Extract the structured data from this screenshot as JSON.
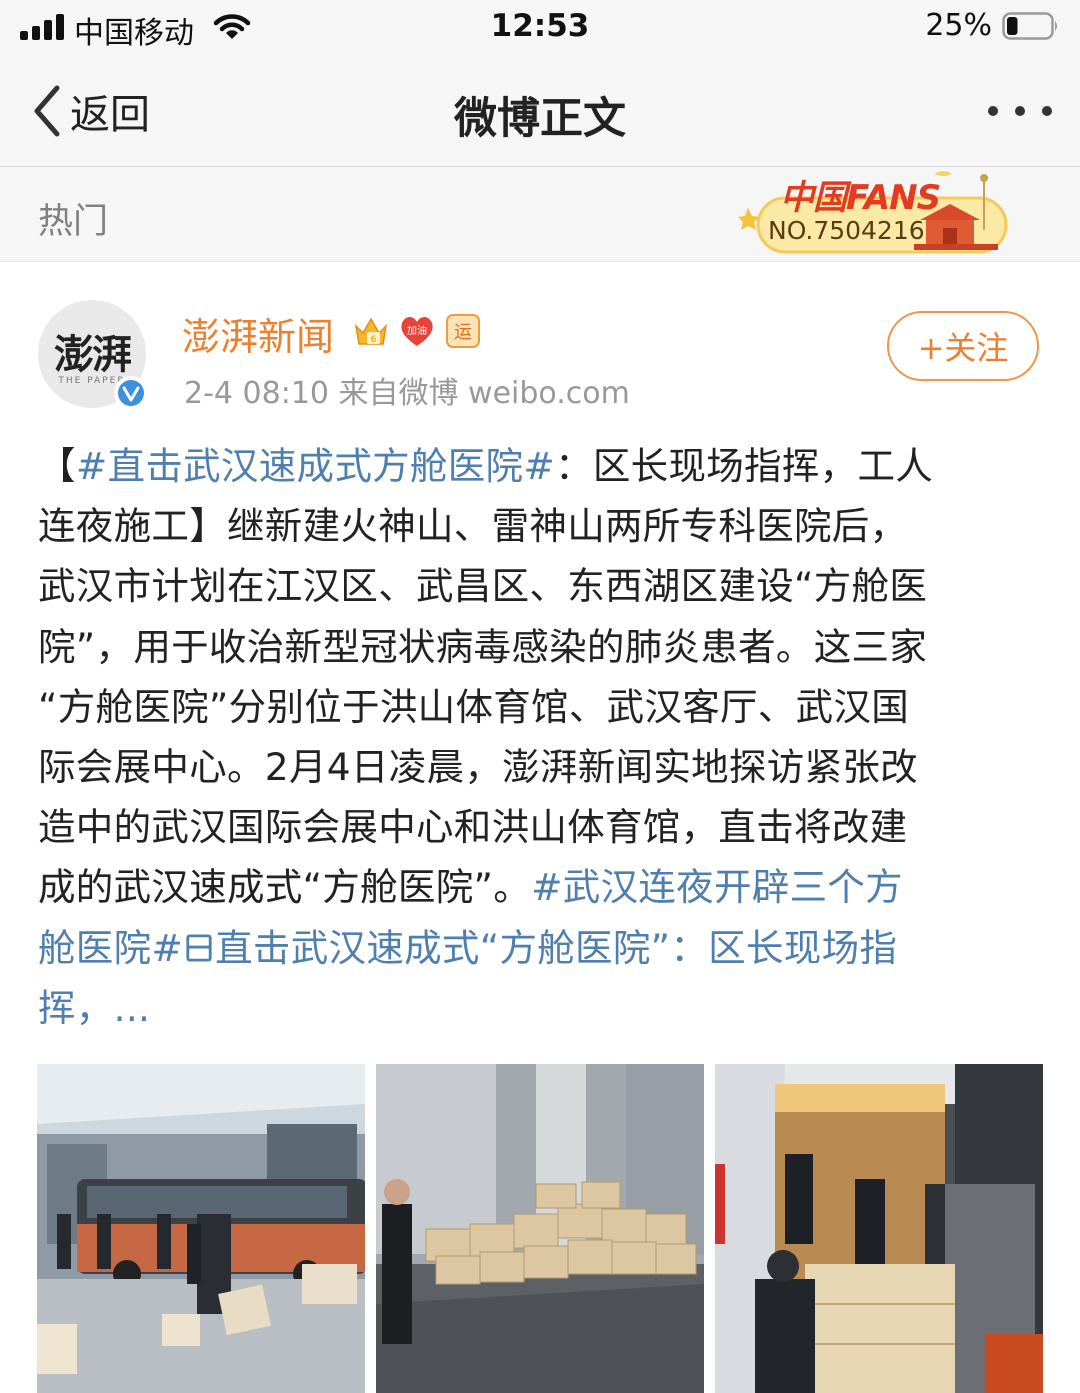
{
  "status_bar": {
    "carrier": "中国移动",
    "time": "12:53",
    "battery": "25%",
    "battery_level": 0.25
  },
  "nav": {
    "back_label": "返回",
    "title": "微博正文"
  },
  "section": {
    "hot_label": "热门",
    "fans_badge": {
      "title": "中国FANS",
      "number": "NO.7504216"
    }
  },
  "post": {
    "avatar_text": "澎湃",
    "avatar_subtext": "THE PAPER",
    "username": "澎湃新闻",
    "badges": [
      "crown-icon",
      "heart-jiayou-icon",
      "yun-icon"
    ],
    "badge_heart_text": "加油",
    "badge_yun_text": "运",
    "meta": "2-4 08:10  来自微博 weibo.com",
    "follow_label": "+关注",
    "body_lines": [
      {
        "pre": "【",
        "topic": "#直击武汉速成式方舱医院#",
        "post": "：区长现场指挥，工人"
      },
      {
        "pre": "连夜施工】继新建火神山、雷神山两所专科医院后，",
        "topic": "",
        "post": ""
      },
      {
        "pre": "武汉市计划在江汉区、武昌区、东西湖区建设“方舱医",
        "topic": "",
        "post": ""
      },
      {
        "pre": "院”，用于收治新型冠状病毒感染的肺炎患者。这三家",
        "topic": "",
        "post": ""
      },
      {
        "pre": "“方舱医院”分别位于洪山体育馆、武汉客厅、武汉国",
        "topic": "",
        "post": ""
      },
      {
        "pre": "际会展中心。2月4日凌晨，澎湃新闻实地探访紧张改",
        "topic": "",
        "post": ""
      },
      {
        "pre": "造中的武汉国际会展中心和洪山体育馆，直击将改建",
        "topic": "",
        "post": ""
      },
      {
        "pre": "成的武汉速成式“方舱医院”。",
        "topic": "#武汉连夜开辟三个方",
        "post": ""
      },
      {
        "pre": "",
        "topic": "舱医院#",
        "post": ""
      },
      {
        "pre": "",
        "topic": "挥，...",
        "post": ""
      }
    ],
    "video_link": "直击武汉速成式“方舱医院”：区长现场指",
    "photos": [
      "photo-bus-hall",
      "photo-boxes-hall",
      "photo-truck-unloading"
    ]
  },
  "colors": {
    "link": "#4f7fae",
    "brand_orange": "#ee7f2c",
    "meta_gray": "#999999"
  }
}
